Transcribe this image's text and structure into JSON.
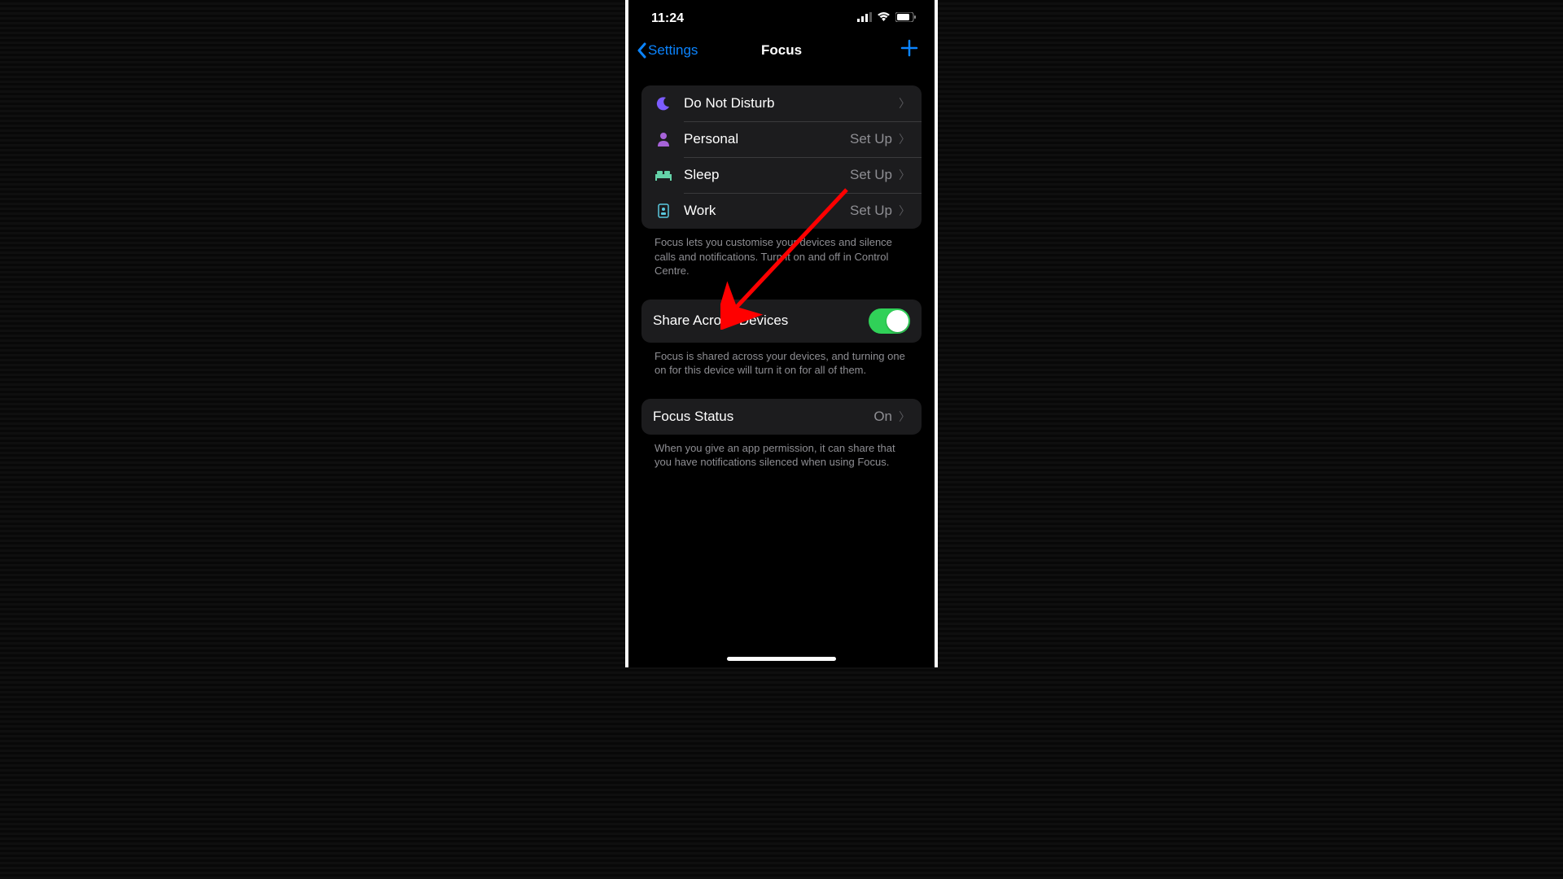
{
  "status": {
    "time": "11:24"
  },
  "nav": {
    "back": "Settings",
    "title": "Focus"
  },
  "focus_modes": [
    {
      "icon": "moon",
      "color": "#7c5cff",
      "label": "Do Not Disturb",
      "value": ""
    },
    {
      "icon": "person",
      "color": "#a763d9",
      "label": "Personal",
      "value": "Set Up"
    },
    {
      "icon": "bed",
      "color": "#64d2a8",
      "label": "Sleep",
      "value": "Set Up"
    },
    {
      "icon": "badge",
      "color": "#5ac8de",
      "label": "Work",
      "value": "Set Up"
    }
  ],
  "focus_footer": "Focus lets you customise your devices and silence calls and notifications. Turn it on and off in Control Centre.",
  "share": {
    "label": "Share Across Devices",
    "on": true
  },
  "share_footer": "Focus is shared across your devices, and turning one on for this device will turn it on for all of them.",
  "status_row": {
    "label": "Focus Status",
    "value": "On"
  },
  "status_footer": "When you give an app permission, it can share that you have notifications silenced when using Focus.",
  "setup_text": "Set Up"
}
